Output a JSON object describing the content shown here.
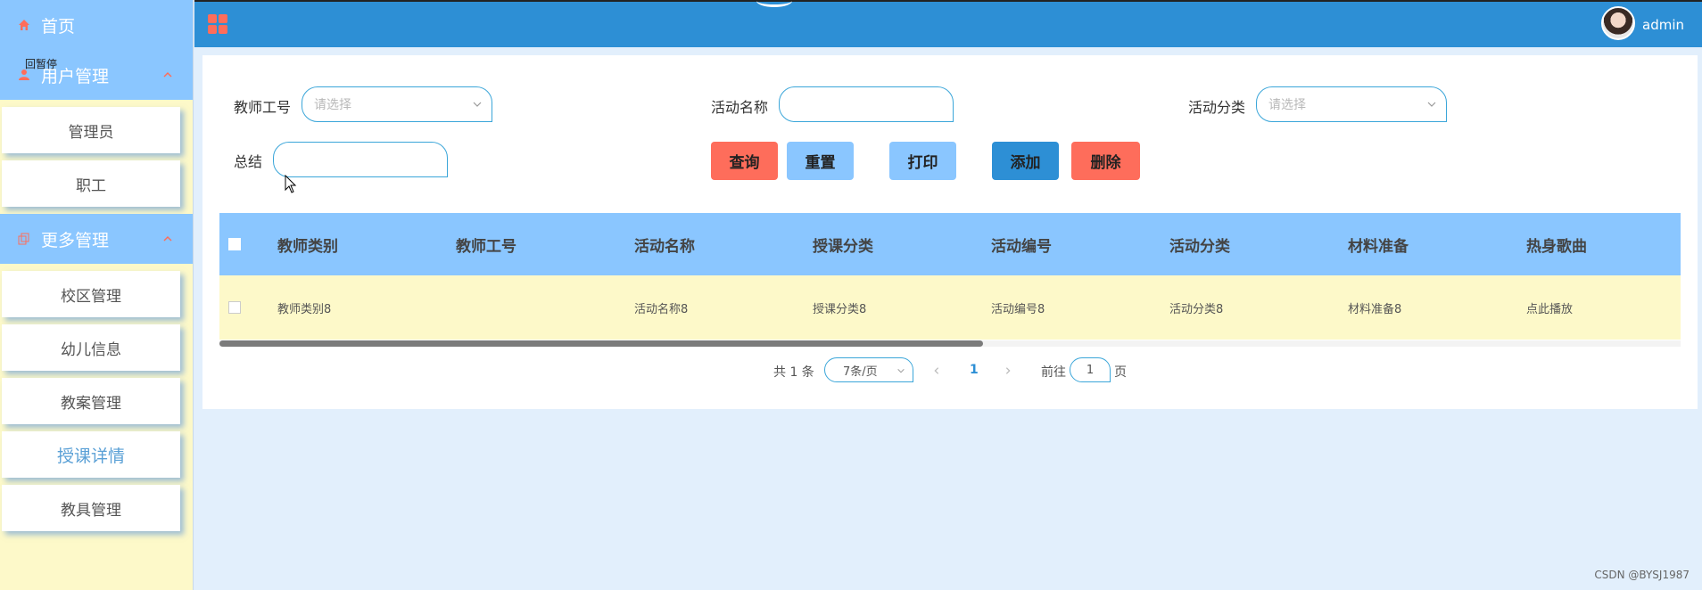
{
  "sidebar": {
    "home": {
      "label": "首页",
      "icon": "home-icon"
    },
    "user_mgmt": {
      "label": "用户管理",
      "overlay": "回暂停",
      "icon": "user-icon"
    },
    "user_items": [
      {
        "label": "管理员"
      },
      {
        "label": "职工"
      }
    ],
    "more_mgmt": {
      "label": "更多管理",
      "icon": "copy-icon"
    },
    "more_items": [
      {
        "label": "校区管理"
      },
      {
        "label": "幼儿信息"
      },
      {
        "label": "教案管理"
      },
      {
        "label": "授课详情",
        "active": true
      },
      {
        "label": "教具管理"
      }
    ]
  },
  "header": {
    "username": "admin",
    "menu_icon": "grid-icon",
    "avatar": "avatar"
  },
  "search_form": {
    "teacher_id": {
      "label": "教师工号",
      "placeholder": "请选择"
    },
    "activity_name": {
      "label": "活动名称",
      "value": ""
    },
    "activity_category": {
      "label": "活动分类",
      "placeholder": "请选择"
    },
    "summary": {
      "label": "总结",
      "value": ""
    }
  },
  "buttons": {
    "query": "查询",
    "reset": "重置",
    "print": "打印",
    "add": "添加",
    "delete": "删除"
  },
  "table": {
    "columns": [
      "教师类别",
      "教师工号",
      "活动名称",
      "授课分类",
      "活动编号",
      "活动分类",
      "材料准备",
      "热身歌曲"
    ],
    "rows": [
      [
        "教师类别8",
        "",
        "活动名称8",
        "授课分类8",
        "活动编号8",
        "活动分类8",
        "材料准备8",
        "点此播放"
      ]
    ]
  },
  "pagination": {
    "total": "共 1 条",
    "page_size": "7条/页",
    "current_page": "1",
    "goto_label": "前往",
    "goto_value": "1",
    "page_suffix": "页"
  },
  "watermark": "CSDN @BYSJ1987",
  "colors": {
    "sidebar_header": "#8ac6ff",
    "sidebar_bg": "#fdf9c9",
    "top_bar": "#2d8fd5",
    "query_btn": "#fe6d5b",
    "reset_btn": "#8ac6ff",
    "add_btn": "#2d8fd5",
    "delete_btn": "#fe6d5b"
  }
}
